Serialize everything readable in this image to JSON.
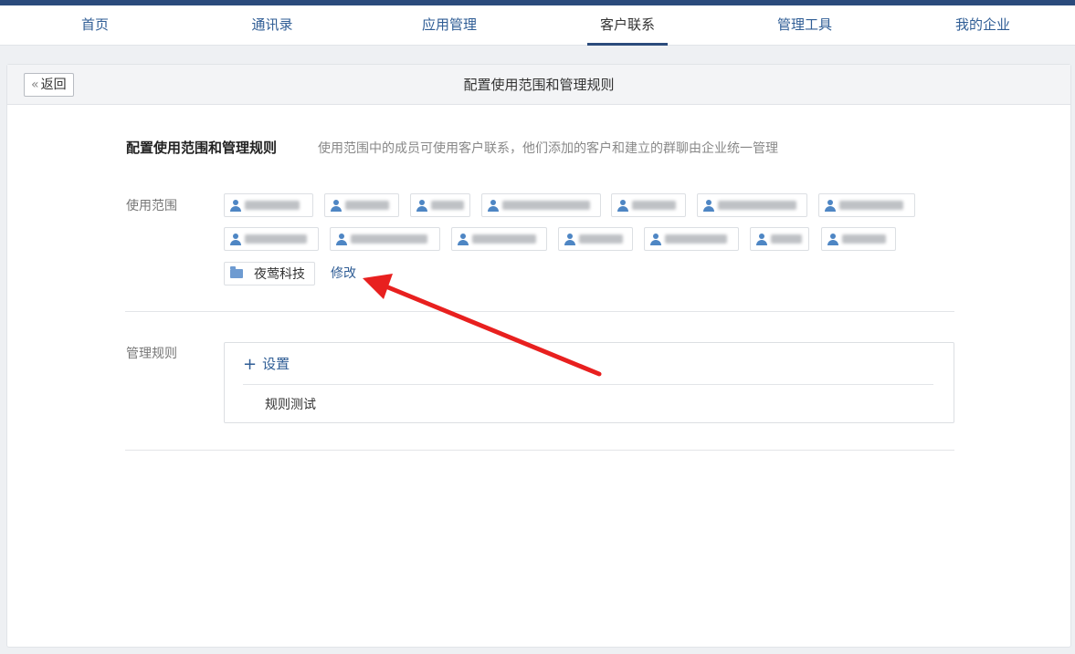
{
  "nav": {
    "items": [
      {
        "label": "首页",
        "active": false
      },
      {
        "label": "通讯录",
        "active": false
      },
      {
        "label": "应用管理",
        "active": false
      },
      {
        "label": "客户联系",
        "active": true
      },
      {
        "label": "管理工具",
        "active": false
      },
      {
        "label": "我的企业",
        "active": false
      }
    ]
  },
  "header": {
    "back_chevron": "«",
    "back_label": "返回",
    "title": "配置使用范围和管理规则"
  },
  "section": {
    "title": "配置使用范围和管理规则",
    "description": "使用范围中的成员可使用客户联系，他们添加的客户和建立的群聊由企业统一管理"
  },
  "scope": {
    "label": "使用范围",
    "member_icon": "user-icon",
    "members_note": "member names are blurred in the screenshot",
    "department": {
      "icon": "folder-icon",
      "name": "夜莺科技"
    },
    "edit_label": "修改"
  },
  "rules": {
    "label": "管理规则",
    "add_icon": "plus-icon",
    "add_label": "设置",
    "items": [
      "规则测试"
    ]
  },
  "colors": {
    "top_bar": "#2b4b7c",
    "link": "#2f5d95",
    "user_icon": "#4e86c4",
    "annotation_arrow": "#e8201f"
  }
}
